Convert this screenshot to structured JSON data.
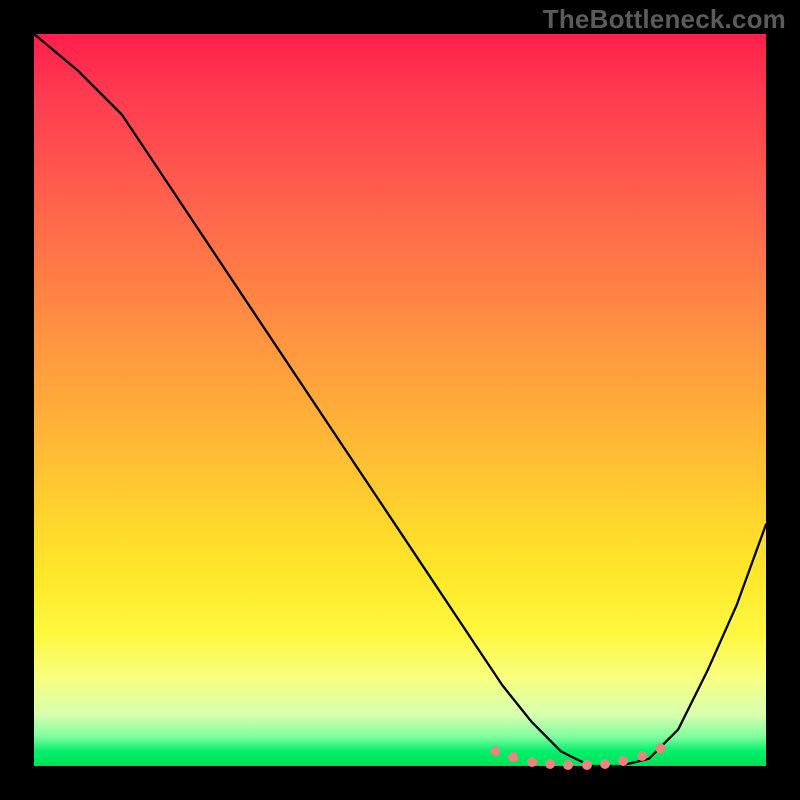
{
  "watermark": "TheBottleneck.com",
  "chart_data": {
    "type": "line",
    "title": "",
    "xlabel": "",
    "ylabel": "",
    "xlim": [
      0,
      100
    ],
    "ylim": [
      0,
      100
    ],
    "grid": false,
    "legend": false,
    "series": [
      {
        "name": "curve",
        "x": [
          0,
          6,
          12,
          18,
          24,
          30,
          36,
          42,
          48,
          54,
          60,
          64,
          68,
          72,
          76,
          80,
          84,
          88,
          92,
          96,
          100
        ],
        "y": [
          100,
          95,
          89,
          80,
          71,
          62,
          53,
          44,
          35,
          26,
          17,
          11,
          6,
          2,
          0,
          0,
          1,
          5,
          13,
          22,
          33
        ]
      }
    ],
    "markers": {
      "name": "flat-region-dots",
      "color": "#e8867f",
      "x": [
        63,
        65.5,
        68,
        70.5,
        73,
        75.5,
        78,
        80.5,
        83,
        85.5
      ],
      "y": [
        2.0,
        1.2,
        0.6,
        0.3,
        0.1,
        0.1,
        0.3,
        0.7,
        1.4,
        2.5
      ]
    }
  }
}
